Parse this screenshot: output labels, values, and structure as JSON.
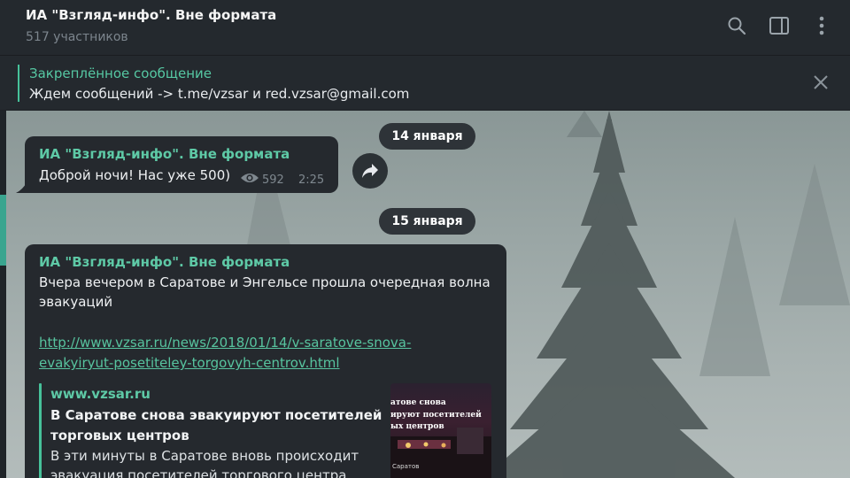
{
  "header": {
    "title": "ИА \"Взгляд-инфо\". Вне формата",
    "subtitle": "517 участников",
    "icons": [
      "search-icon",
      "sidebar-toggle-icon",
      "more-vert-icon"
    ]
  },
  "pinned": {
    "title": "Закреплённое сообщение",
    "text": "Ждем сообщений -> t.me/vzsar и red.vzsar@gmail.com",
    "close_icon": "close-icon"
  },
  "dates": [
    "14 января",
    "15 января"
  ],
  "messages": [
    {
      "author": "ИА \"Взгляд-инфо\". Вне формата",
      "text": "Доброй ночи! Нас уже 500)",
      "views": "592",
      "time": "2:25"
    },
    {
      "author": "ИА \"Взгляд-инфо\". Вне формата",
      "text_lines": [
        "Вчера вечером в Саратове и Энгельсе прошла очередная волна",
        "эвакуаций"
      ],
      "link_lines": [
        "http://www.vzsar.ru/news/2018/01/14/v-saratove-snova-",
        "evakyiryut-posetiteley-torgovyh-centrov.html"
      ],
      "preview": {
        "site": "www.vzsar.ru",
        "title_lines": [
          "В Саратове снова эвакуируют посетителей",
          "торговых центров"
        ],
        "desc_lines": [
          "В эти минуты в Саратове вновь происходит",
          "эвакуация посетителей торгового центра"
        ],
        "thumb_lines": [
          "атове снова",
          "ируют посетителей",
          "ых центров"
        ],
        "thumb_caption": "Саратов"
      }
    }
  ],
  "colors": {
    "accent": "#5ec9a6",
    "bubble": "#25292e",
    "header": "#24292e"
  }
}
